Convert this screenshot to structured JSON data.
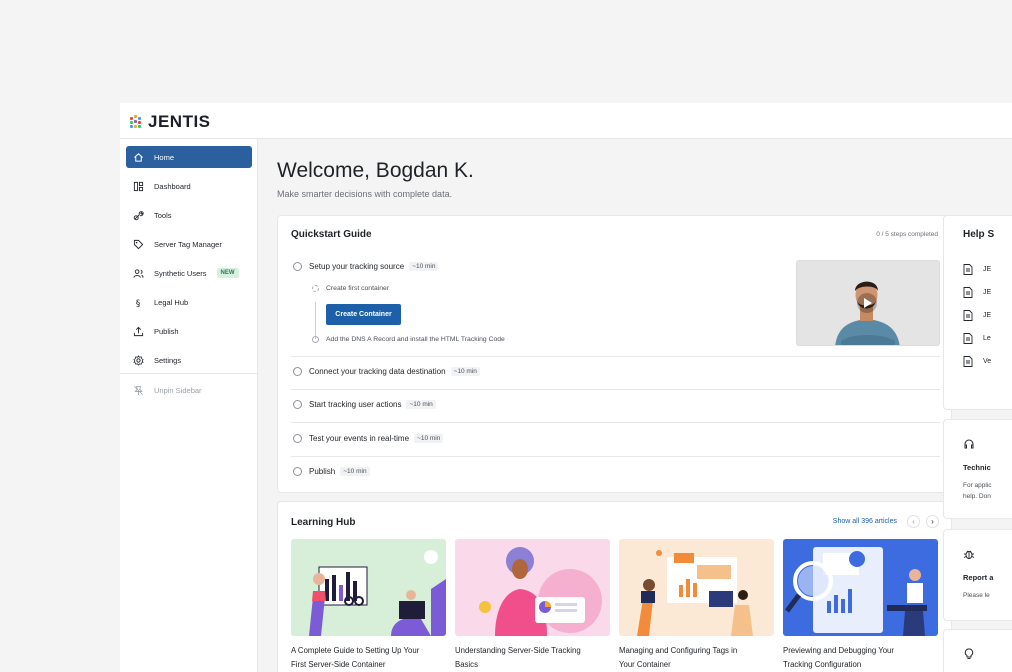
{
  "brand": {
    "name": "JENTIS"
  },
  "sidebar": {
    "items": [
      {
        "label": "Home",
        "icon": "home-icon"
      },
      {
        "label": "Dashboard",
        "icon": "dashboard-icon"
      },
      {
        "label": "Tools",
        "icon": "tools-icon"
      },
      {
        "label": "Server Tag Manager",
        "icon": "tag-icon"
      },
      {
        "label": "Synthetic Users",
        "icon": "users-icon",
        "badge": "NEW"
      },
      {
        "label": "Legal Hub",
        "icon": "section-icon"
      },
      {
        "label": "Publish",
        "icon": "publish-icon"
      },
      {
        "label": "Settings",
        "icon": "settings-icon"
      }
    ],
    "unpin_label": "Unpin Sidebar"
  },
  "main": {
    "welcome": "Welcome, Bogdan K.",
    "subtitle": "Make smarter decisions with complete data."
  },
  "quickstart": {
    "title": "Quickstart Guide",
    "progress": "0 / 5 steps completed",
    "steps": [
      {
        "label": "Setup your tracking source",
        "duration": "~10 min"
      },
      {
        "label": "Connect your tracking data destination",
        "duration": "~10 min"
      },
      {
        "label": "Start tracking user actions",
        "duration": "~10 min"
      },
      {
        "label": "Test your events in real-time",
        "duration": "~10 min"
      },
      {
        "label": "Publish",
        "duration": "~10 min"
      }
    ],
    "substeps": {
      "create_first": "Create first container",
      "create_button": "Create Container",
      "dns": "Add the DNS A Record and install the HTML Tracking Code"
    }
  },
  "learning_hub": {
    "title": "Learning Hub",
    "show_all": "Show all 396 articles",
    "articles": [
      {
        "title_line1": "A Complete Guide to Setting Up Your",
        "title_line2": "First Server-Side Container"
      },
      {
        "title_line1": "Understanding Server-Side Tracking",
        "title_line2": "Basics"
      },
      {
        "title_line1": "Managing and Configuring Tags in",
        "title_line2": "Your Container"
      },
      {
        "title_line1": "Previewing and Debugging Your",
        "title_line2": "Tracking Configuration"
      }
    ]
  },
  "help": {
    "title": "Help S",
    "items": [
      "JE",
      "JE",
      "JE",
      "Le",
      "Ve"
    ]
  },
  "technical": {
    "title": "Technic",
    "text_line1": "For applic",
    "text_line2": "help. Don"
  },
  "report": {
    "title": "Report a",
    "text": "Please le"
  },
  "colors": {
    "accent": "#2c5f9e",
    "button": "#1d5fa8",
    "badge_bg": "#d8f0e2",
    "badge_text": "#2b7a4b"
  }
}
